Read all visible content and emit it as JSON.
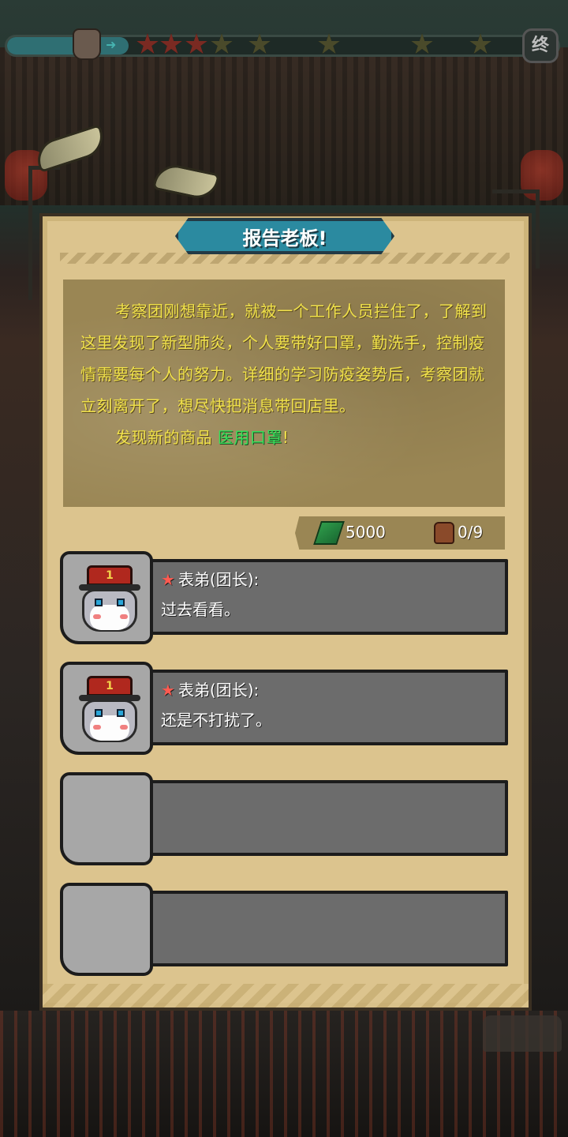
{
  "progress": {
    "stars_total": 8,
    "stars_filled": 3,
    "end_label": "终"
  },
  "dialog": {
    "title": "报告老板!",
    "story": {
      "paragraph": "考察团刚想靠近，就被一个工作人员拦住了，了解到这里发现了新型肺炎，个人要带好口罩，勤洗手，控制疫情需要每个人的努力。详细的学习防疫姿势后，考察团就立刻离开了，想尽快把消息带回店里。",
      "found_prefix": "发现新的商品",
      "found_item": "医用口罩",
      "found_suffix": "!"
    },
    "stats": {
      "money_icon": "cash-icon",
      "money": "5000",
      "bag_icon": "backpack-icon",
      "bag": "0/9"
    },
    "messages": [
      {
        "speaker": "表弟(团长):",
        "text": "过去看看。"
      },
      {
        "speaker": "表弟(团长):",
        "text": "还是不打扰了。"
      }
    ]
  },
  "colors": {
    "panel": "#dcc48e",
    "title_pill": "#2b8aa0",
    "story_text": "#f1e24a",
    "item_highlight": "#36e05a",
    "bubble": "#6c6c6c"
  }
}
